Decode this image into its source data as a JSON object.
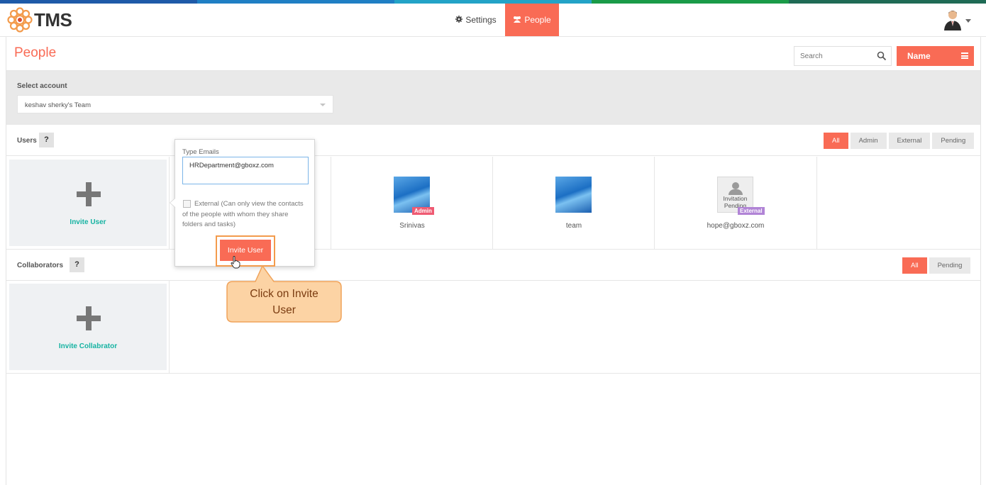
{
  "app": {
    "name": "TMS",
    "stripe_colors": [
      "#1e5aa8",
      "#1f7fc4",
      "#23a3c7",
      "#1a9b48",
      "#1f6b55"
    ]
  },
  "nav": {
    "settings_label": "Settings",
    "people_label": "People",
    "settings_icon": "gear-icon",
    "people_icon": "users-icon"
  },
  "header": {
    "title": "People",
    "search_placeholder": "Search",
    "sort_label": "Name"
  },
  "account": {
    "label": "Select account",
    "selected": "keshav sherky's Team"
  },
  "users": {
    "title": "Users",
    "help": "?",
    "filters": [
      "All",
      "Admin",
      "External",
      "Pending"
    ],
    "active_filter": "All",
    "invite_label": "Invite User",
    "list": [
      {
        "name": "Srinivas",
        "badge": "Admin"
      },
      {
        "name": "team",
        "badge": ""
      },
      {
        "name": "hope@gboxz.com",
        "badge": "External",
        "placeholder_text": "Invitation Pending"
      }
    ]
  },
  "collaborators": {
    "title": "Collaborators",
    "help": "?",
    "filters": [
      "All",
      "Pending"
    ],
    "active_filter": "All",
    "invite_label": "Invite Collabrator"
  },
  "popover": {
    "label": "Type Emails",
    "email_value": "HRDepartment@gboxz.com",
    "external_text": "External (Can only view the contacts of the people with whom they share folders and tasks)",
    "button_label": "Invite User"
  },
  "callout": {
    "line1": "Click on Invite",
    "line2": "User"
  },
  "colors": {
    "accent": "#f96b55",
    "teal": "#16b3a2",
    "admin_badge": "#ef5b73",
    "external_badge": "#b184d6",
    "callout_fill": "#fcd3a4",
    "callout_border": "#f0a35a"
  }
}
